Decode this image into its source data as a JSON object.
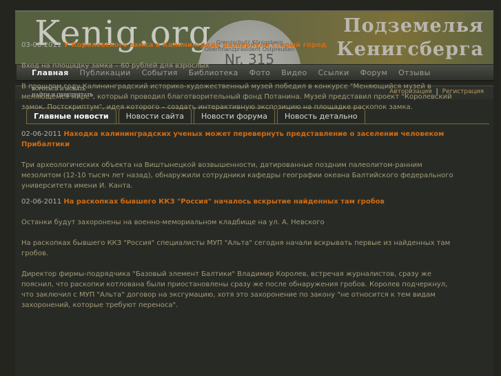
{
  "header": {
    "logo": "Kenig.org",
    "title_line1": "Подземелья",
    "title_line2": "Кенигсберга",
    "tag_line1": "Grenzschutz Königsberg",
    "tag_line2": "Oberfinanzpräsident Ostpreußen",
    "tag_number": "Nr. 315"
  },
  "nav": [
    "Главная",
    "Публикации",
    "События",
    "Библиотека",
    "Фото",
    "Видео",
    "Ссылки",
    "Форум",
    "Отзывы"
  ],
  "motto": {
    "line1": "БОРОТЬСЯ И ИСКАТЬ",
    "line2": "НАЙТИ И ПЕРЕПРЯТАТЬ"
  },
  "auth": {
    "login": "Авторизация",
    "separator": "|",
    "register": "Регистрация"
  },
  "tabs": [
    "Главные новости",
    "Новости сайта",
    "Новости форума",
    "Новость детально"
  ],
  "news": [
    {
      "date": "03-06-2011",
      "title": "У Королевского замка в Калининграде развернули старый город",
      "paragraphs": [
        "Вход на площадку замка – 60 рублей для взрослых",
        "В прошлом году Калининградский историко-художественный музей победил в конкурсе \"Меняющийся музей в меняющемся мире\", который проводил благотворительный фонд Потанина. Музей представил проект \"Королевский замок. Постскриптум\", идея которого – создать интерактивную экспозицию на площадке раскопок замка."
      ]
    },
    {
      "date": "02-06-2011",
      "title": "Находка калининградских ученых может перевернуть представление о заселении человеком Прибалтики",
      "paragraphs": [
        "Три археологических объекта на Виштынецкой возвышенности, датированные поздним палеолитом-ранним мезолитом (12-10 тысяч лет назад), обнаружили сотрудники кафедры географии океана Балтийского федерального университета имени И. Канта."
      ]
    },
    {
      "date": "02-06-2011",
      "title": "На раскопках бывшего ККЗ \"Россия\" началось вскрытие найденных там гробов",
      "paragraphs": [
        "Останки будут захоронены на военно-мемориальном кладбище на ул. А. Невского",
        "На раскопках бывшего ККЗ \"Россия\" специалисты МУП \"Альта\" сегодня начали вскрывать первые из найденных там гробов.",
        "Директор фирмы-подрядчика \"Базовый элемент Балтики\" Владимир Королев, встречая журналистов, сразу же пояснил, что раскопки котлована были приостановлены сразу же после обнаружения гробов. Королев подчеркнул, что заключил с МУП \"Альта\" договор на эксгумацию, хотя это захоронение по закону \"не относится к тем видам захоронений, которые требуют переноса\"."
      ]
    }
  ]
}
